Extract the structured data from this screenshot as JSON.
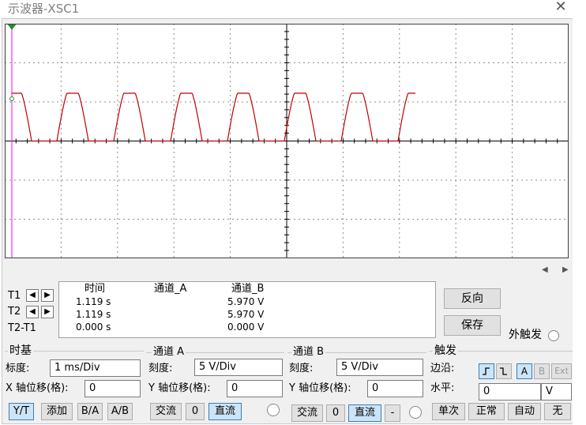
{
  "window": {
    "title": "示波器-XSC1",
    "close": "✕"
  },
  "readout": {
    "headers": {
      "time": "时间",
      "ch_a": "通道_A",
      "ch_b": "通道_B"
    },
    "rows": [
      {
        "label": "T1",
        "time": "1.119 s",
        "ch_a": "",
        "ch_b": "5.970 V"
      },
      {
        "label": "T2",
        "time": "1.119 s",
        "ch_a": "",
        "ch_b": "5.970 V"
      },
      {
        "label": "T2-T1",
        "time": "0.000 s",
        "ch_a": "",
        "ch_b": "0.000 V"
      }
    ]
  },
  "actions": {
    "reverse": "反向",
    "save": "保存",
    "ext_trigger": "外触发"
  },
  "timebase": {
    "title": "时基",
    "scale_label": "标度:",
    "scale_value": "1 ms/Div",
    "xpos_label": "X 轴位移(格):",
    "xpos_value": "0",
    "modes": [
      "Y/T",
      "添加",
      "B/A",
      "A/B"
    ],
    "active_mode": "Y/T"
  },
  "channel_a": {
    "title": "通道 A",
    "scale_label": "刻度:",
    "scale_value": "5  V/Div",
    "ypos_label": "Y 轴位移(格):",
    "ypos_value": "0",
    "coupling": [
      "交流",
      "0",
      "直流"
    ],
    "active_coupling": "直流"
  },
  "channel_b": {
    "title": "通道 B",
    "scale_label": "刻度:",
    "scale_value": "5  V/Div",
    "ypos_label": "Y 轴位移(格):",
    "ypos_value": "0",
    "coupling": [
      "交流",
      "0",
      "直流",
      "-"
    ],
    "active_coupling": "直流"
  },
  "trigger": {
    "title": "触发",
    "edge_label": "边沿:",
    "edge_buttons": [
      "A",
      "B",
      "Ext"
    ],
    "level_label": "水平:",
    "level_value": "0",
    "level_unit": "V",
    "modes": [
      "单次",
      "正常",
      "自动",
      "无"
    ]
  },
  "colors": {
    "waveform": "#c00000",
    "cursor": "#ff00ff",
    "grid": "#8c8c8c",
    "axis": "#000000"
  }
}
